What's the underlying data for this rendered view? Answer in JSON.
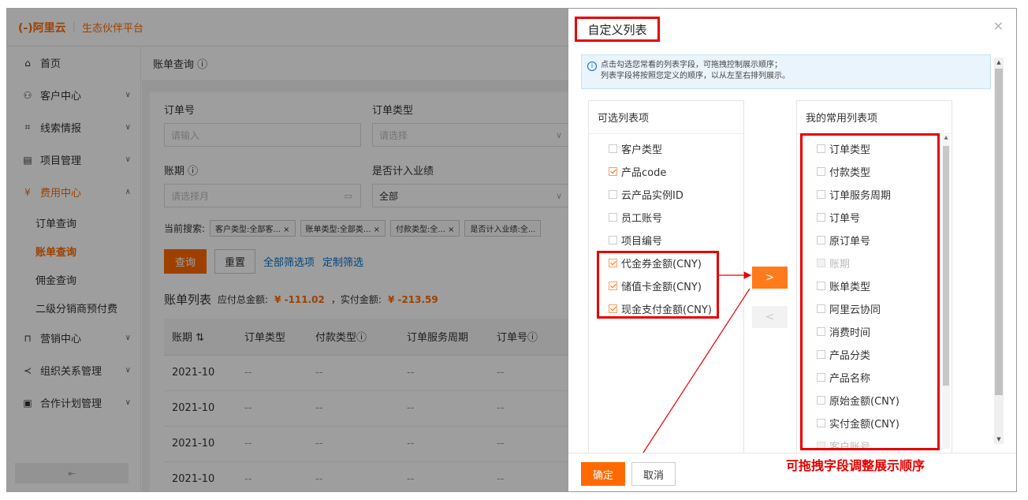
{
  "brand": {
    "logo": "(-)阿里云",
    "subtitle": "生态伙伴平台"
  },
  "sidebar": {
    "items": [
      {
        "label": "首页",
        "icon": "home-icon"
      },
      {
        "label": "客户中心",
        "icon": "users-icon"
      },
      {
        "label": "线索情报",
        "icon": "link-icon"
      },
      {
        "label": "项目管理",
        "icon": "list-icon"
      },
      {
        "label": "费用中心",
        "icon": "yen-icon"
      }
    ],
    "sub": [
      "订单查询",
      "账单查询",
      "佣金查询",
      "二级分销商预付费"
    ],
    "more": [
      {
        "label": "营销中心",
        "icon": "bag-icon"
      },
      {
        "label": "组织关系管理",
        "icon": "share-icon"
      },
      {
        "label": "合作计划管理",
        "icon": "calendar-icon"
      }
    ],
    "collapse_glyph": "⇤"
  },
  "main": {
    "breadcrumb": "账单查询 ⓘ",
    "order_no_label": "订单号",
    "order_no_placeholder": "请输入",
    "order_type_label": "订单类型",
    "order_type_placeholder": "请选择",
    "period_label": "账期 ⓘ",
    "period_placeholder": "请选择月",
    "perf_label": "是否计入业绩",
    "perf_value": "全部",
    "current_search_label": "当前搜索:",
    "tags": [
      "客户类型:全部客... ×",
      "账单类型:全部类... ×",
      "付款类型:全... ×",
      "是否计入业绩:全..."
    ],
    "query_btn": "查询",
    "reset_btn": "重置",
    "all_filters_link": "全部筛选项",
    "custom_filter_link": "定制筛选",
    "list_title": "账单列表",
    "payable_label": "应付总金额:",
    "payable_value": "¥ -111.02",
    "paid_label": "，实付金额:",
    "paid_value": "¥ -213.59",
    "columns": [
      "账期 ⇅",
      "订单类型",
      "付款类型ⓘ",
      "订单服务周期",
      "订单号ⓘ"
    ],
    "rows": [
      [
        "2021-10",
        "--",
        "--",
        "--",
        "--"
      ],
      [
        "2021-10",
        "--",
        "--",
        "--",
        "--"
      ],
      [
        "2021-10",
        "--",
        "--",
        "--",
        "--"
      ],
      [
        "2021-10",
        "--",
        "--",
        "--",
        "--"
      ]
    ]
  },
  "dialog": {
    "title": "自定义列表",
    "close": "×",
    "tip_line1": "点击勾选您常看的列表字段，可拖拽控制展示顺序；",
    "tip_line2": "列表字段将按照您定义的顺序，以从左至右排列展示。",
    "left_title": "可选列表项",
    "left_items": [
      {
        "label": "客户类型",
        "checked": false
      },
      {
        "label": "产品code",
        "checked": true
      },
      {
        "label": "云产品实例ID",
        "checked": false
      },
      {
        "label": "员工账号",
        "checked": false
      },
      {
        "label": "项目编号",
        "checked": false
      },
      {
        "label": "代金券金额(CNY)",
        "checked": true
      },
      {
        "label": "储值卡金额(CNY)",
        "checked": true
      },
      {
        "label": "现金支付金额(CNY)",
        "checked": true
      }
    ],
    "right_title": "我的常用列表项",
    "right_items": [
      {
        "label": "订单类型",
        "disabled": false
      },
      {
        "label": "付款类型",
        "disabled": false
      },
      {
        "label": "订单服务周期",
        "disabled": false
      },
      {
        "label": "订单号",
        "disabled": false
      },
      {
        "label": "原订单号",
        "disabled": false
      },
      {
        "label": "账期",
        "disabled": true
      },
      {
        "label": "账单类型",
        "disabled": false
      },
      {
        "label": "阿里云协同",
        "disabled": false
      },
      {
        "label": "消费时间",
        "disabled": false
      },
      {
        "label": "产品分类",
        "disabled": false
      },
      {
        "label": "产品名称",
        "disabled": false
      },
      {
        "label": "原始金额(CNY)",
        "disabled": false
      },
      {
        "label": "实付金额(CNY)",
        "disabled": false
      },
      {
        "label": "客户账号",
        "disabled": true
      }
    ],
    "move_right": ">",
    "move_left": "<",
    "ok": "确定",
    "cancel": "取消",
    "annotation": "可拖拽字段调整展示顺序",
    "colors": {
      "accent": "#ff6a00",
      "highlight": "#e60000"
    }
  }
}
